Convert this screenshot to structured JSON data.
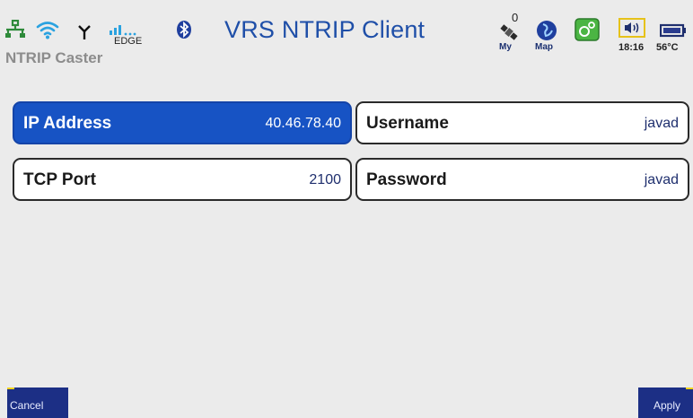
{
  "status": {
    "network_label": "EDGE",
    "satellite_count": "0",
    "my_label": "My",
    "map_label": "Map",
    "time": "18:16",
    "temperature": "56°C"
  },
  "title": "VRS NTRIP Client",
  "section": {
    "title": "NTRIP Caster"
  },
  "fields": [
    {
      "label": "IP Address",
      "value": "40.46.78.40"
    },
    {
      "label": "Username",
      "value": "javad"
    },
    {
      "label": "TCP Port",
      "value": "2100"
    },
    {
      "label": "Password",
      "value": "javad"
    }
  ],
  "softkeys": {
    "cancel": "Cancel",
    "apply": "Apply"
  },
  "colors": {
    "title": "#1f4fa8",
    "selected_field": "#1753c4",
    "softkey": "#1c2f85",
    "section_title": "#8c8c8c"
  },
  "icons": [
    "ethernet-icon",
    "wifi-icon",
    "antenna-icon",
    "cellular-signal-icon",
    "bluetooth-icon",
    "satellite-icon",
    "map-globe-icon",
    "settings-icon",
    "speaker-icon",
    "battery-icon"
  ]
}
